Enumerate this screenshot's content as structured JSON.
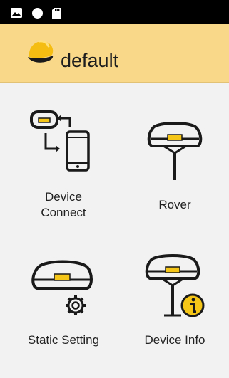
{
  "status_bar": {
    "icons": [
      "image-icon",
      "circle-icon",
      "sd-card-icon"
    ]
  },
  "app_bar": {
    "title": "default",
    "logo_icon": "helmet-icon"
  },
  "menu": {
    "items": [
      {
        "label_line1": "Device",
        "label_line2": "Connect",
        "icon": "device-connect-icon"
      },
      {
        "label": "Rover",
        "icon": "rover-icon"
      },
      {
        "label": "Static Setting",
        "icon": "static-setting-icon"
      },
      {
        "label": "Device Info",
        "icon": "device-info-icon"
      }
    ]
  },
  "colors": {
    "status_bar": "#000000",
    "app_bar": "#f9d889",
    "background": "#f2f2f2",
    "accent_yellow": "#f5c518",
    "icon_stroke": "#1a1a1a"
  }
}
